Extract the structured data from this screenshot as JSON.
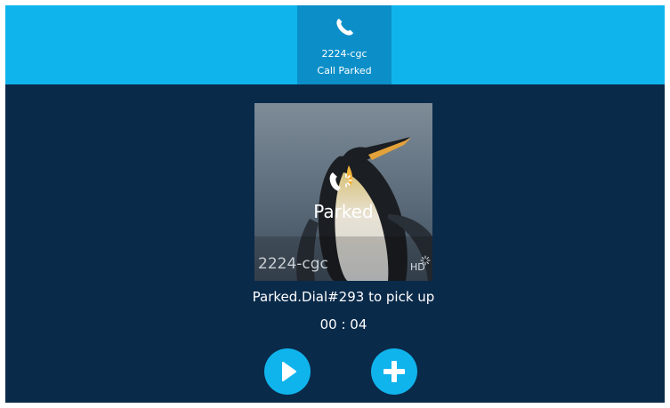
{
  "header": {
    "call_tab": {
      "icon": "phone-icon",
      "number": "2224-cgc",
      "status": "Call Parked"
    }
  },
  "main": {
    "contact_photo": {
      "overlay_icon": "parked-call-icon",
      "overlay_label": "Parked",
      "name": "2224-cgc",
      "badge": "HD"
    },
    "status_text": "Parked.Dial#293 to pick up",
    "timer": "00 : 04"
  },
  "actions": [
    {
      "name": "resume",
      "icon": "play-icon"
    },
    {
      "name": "add",
      "icon": "plus-icon"
    }
  ],
  "colors": {
    "background": "#0a2a4a",
    "topbar": "#10b4ec",
    "active_tab": "#0c8fc8",
    "button": "#10b4ec"
  }
}
